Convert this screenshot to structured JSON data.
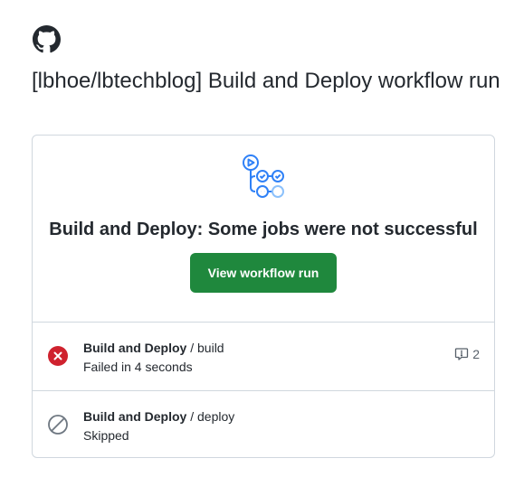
{
  "email": {
    "title": "[lbhoe/lbtechblog] Build and Deploy workflow run"
  },
  "summary": {
    "heading": "Build and Deploy: Some jobs were not successful",
    "button_label": "View workflow run"
  },
  "jobs": [
    {
      "workflow": "Build and Deploy",
      "separator": " / ",
      "job": "build",
      "status": "Failed in 4 seconds",
      "icon": "failed-x-icon",
      "annotations": "2"
    },
    {
      "workflow": "Build and Deploy",
      "separator": " / ",
      "job": "deploy",
      "status": "Skipped",
      "icon": "skipped-icon"
    }
  ],
  "colors": {
    "primary_button": "#1f883d",
    "failure": "#cf222e",
    "skipped": "#6e7781",
    "workflow_icon": "#2f81f7",
    "border": "#d0d7de"
  }
}
